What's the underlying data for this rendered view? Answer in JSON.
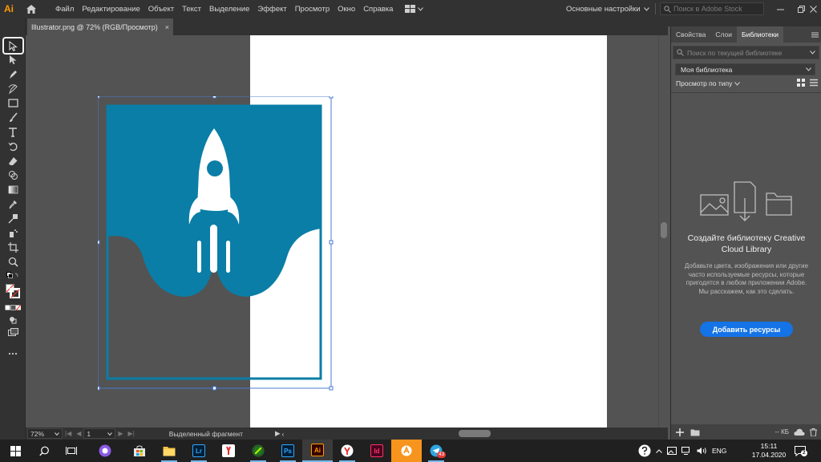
{
  "app": {
    "logo": "Ai",
    "menu": [
      "Файл",
      "Редактирование",
      "Объект",
      "Текст",
      "Выделение",
      "Эффект",
      "Просмотр",
      "Окно",
      "Справка"
    ],
    "workspace": "Основные настройки",
    "stock_search_placeholder": "Поиск в Adobe Stock"
  },
  "document_tab": {
    "title": "Illustrator.png @ 72% (RGB/Просмотр)",
    "close": "×"
  },
  "status_bar": {
    "zoom": "72%",
    "page": "1",
    "tool_status": "Выделенный фрагмент"
  },
  "panel": {
    "tabs": [
      "Свойства",
      "Слои",
      "Библиотеки"
    ],
    "active_tab": "Библиотеки",
    "search_placeholder": "Поиск по текущей библиотеке",
    "library_select": "Моя библиотека",
    "view_by": "Просмотр по типу",
    "empty_title": "Создайте библиотеку Creative Cloud Library",
    "empty_description": "Добавьте цвета, изображения или другие часто используемые ресурсы, которые пригодятся в любом приложении Adobe. Мы расскажем, как это сделать.",
    "add_button": "Добавить ресурсы",
    "footer_size": "-- КБ"
  },
  "artwork": {
    "primary_color": "#0a7ea6",
    "background_color": "#ffffff"
  },
  "taskbar": {
    "apps": [
      "start-icon",
      "search-icon",
      "task-view-icon",
      "cortana-icon",
      "store-icon",
      "explorer-icon",
      "lightroom-icon",
      "yandex-browser-icon",
      "corel-icon",
      "photoshop-icon",
      "illustrator-icon",
      "yandex-icon",
      "indesign-icon",
      "avast-icon",
      "telegram-icon"
    ],
    "lightroom_label": "Lr",
    "photoshop_label": "Ps",
    "illustrator_label": "Ai",
    "indesign_label": "Id",
    "telegram_badge": "43",
    "language": "ENG",
    "time": "15:11",
    "date": "17.04.2020",
    "notifications": "2"
  }
}
